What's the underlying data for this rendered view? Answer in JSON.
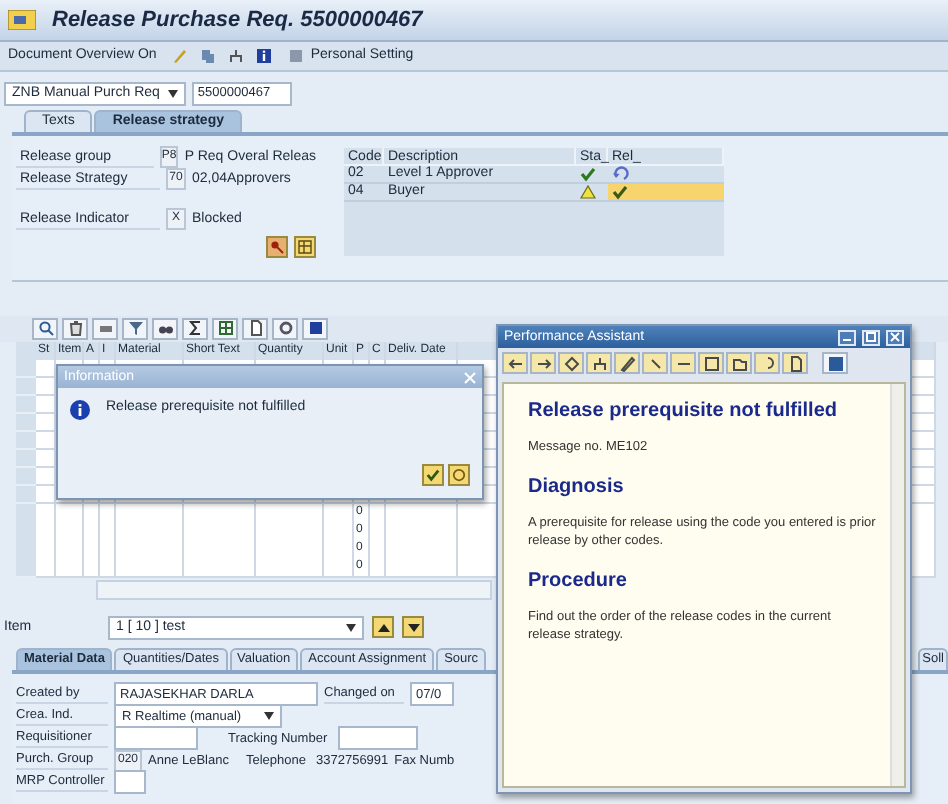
{
  "window": {
    "title": "Release Purchase Req. 5500000467"
  },
  "toolbar": {
    "buttons": [
      {
        "label": "Document Overview On"
      },
      {
        "label": "Personal Setting"
      }
    ]
  },
  "header": {
    "doc_type": "ZNB Manual Purch Req",
    "doc_number": "5500000467"
  },
  "header_tabs": [
    {
      "label": "Texts",
      "selected": false
    },
    {
      "label": "Release strategy",
      "selected": true
    }
  ],
  "release_fields": [
    {
      "label": "Release group",
      "code": "P8",
      "value": "P Req Overal Releas"
    },
    {
      "label": "Release Strategy",
      "code": "70",
      "value": "02,04Approvers"
    },
    {
      "label": "Release Indicator",
      "code": "X",
      "value": "Blocked"
    }
  ],
  "codes_table": {
    "columns": [
      "Code",
      "Description",
      "Sta_",
      "Rel_"
    ],
    "rows": [
      {
        "code": "02",
        "description": "Level 1 Approver",
        "kind": "released"
      },
      {
        "code": "04",
        "description": "Buyer",
        "kind": "pending"
      }
    ]
  },
  "items_table": {
    "columns": [
      "St",
      "Item",
      "A",
      "I",
      "Material",
      "Short Text",
      "Quantity",
      "Unit",
      "P",
      "C",
      "Deliv. Date"
    ],
    "rows": [
      {
        "p": "0"
      },
      {
        "p": "0"
      },
      {
        "p": "0"
      },
      {
        "p": "0"
      }
    ]
  },
  "item_selector": {
    "label": "Item",
    "value": "1 [ 10 ] test"
  },
  "item_tabs": [
    {
      "label": "Material Data",
      "selected": true
    },
    {
      "label": "Quantities/Dates",
      "selected": false
    },
    {
      "label": "Valuation",
      "selected": false
    },
    {
      "label": "Account Assignment",
      "selected": false
    },
    {
      "label": "Sourc",
      "selected": false
    },
    {
      "label": "Soll",
      "selected": false
    }
  ],
  "item_details": {
    "created_by_label": "Created by",
    "created_by": "RAJASEKHAR DARLA",
    "changed_on_label": "Changed on",
    "changed_on": "07/0",
    "crea_ind_label": "Crea. Ind.",
    "crea_ind": "R Realtime (manual)",
    "requisitioner_label": "Requisitioner",
    "tracking_label": "Tracking Number",
    "purch_group_label": "Purch. Group",
    "purch_group_code": "020",
    "purch_group_name": "Anne LeBlanc",
    "telephone_label": "Telephone",
    "telephone": "3372756991",
    "fax_label": "Fax Numb",
    "mrp_label": "MRP Controller"
  },
  "info_dialog": {
    "title": "Information",
    "message": "Release prerequisite not fulfilled"
  },
  "assistant": {
    "title": "Performance Assistant",
    "heading": "Release prerequisite not fulfilled",
    "message_no": "Message no. ME102",
    "sections": [
      {
        "heading": "Diagnosis",
        "text": "A prerequisite for release using the code you entered is prior release by other codes."
      },
      {
        "heading": "Procedure",
        "text": "Find out the order of the release codes in the current release strategy."
      }
    ]
  }
}
